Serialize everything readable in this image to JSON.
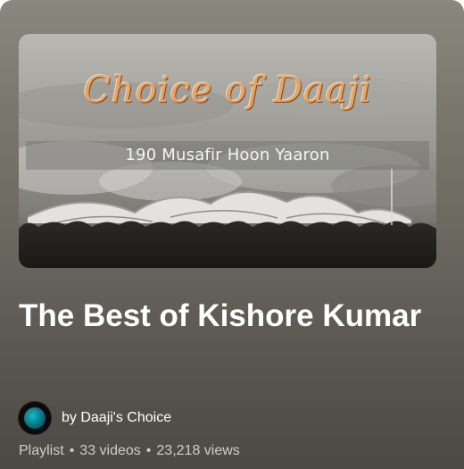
{
  "thumbnail": {
    "script_title": "Choice of Daaji",
    "subtitle": "190 Musafir Hoon Yaaron"
  },
  "playlist": {
    "title": "The Best of Kishore Kumar",
    "channel": "by Daaji's Choice",
    "type": "Playlist",
    "video_count": "33 videos",
    "views": "23,218 views",
    "separator": "•"
  },
  "colors": {
    "script_text": "#e6a568",
    "title_text": "#ffffff",
    "meta_text": "#cfcdc7",
    "avatar_accent": "#14b8c8"
  },
  "icons": {
    "avatar": "channel-avatar"
  }
}
